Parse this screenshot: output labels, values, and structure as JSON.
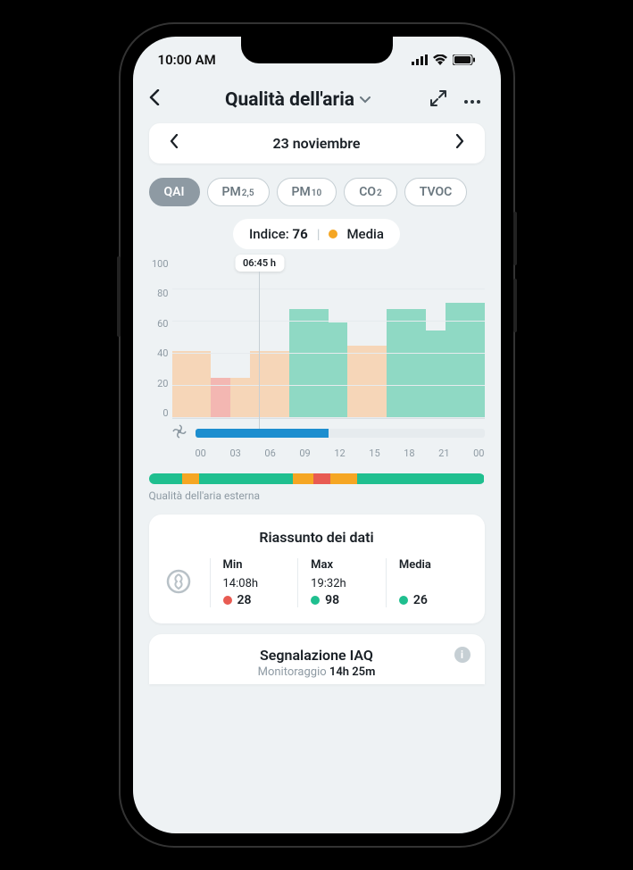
{
  "status_bar": {
    "time": "10:00 AM"
  },
  "header": {
    "title": "Qualità dell'aria"
  },
  "date_selector": {
    "date": "23 noviembre"
  },
  "chips": [
    {
      "label": "QAI",
      "sub": "",
      "active": true
    },
    {
      "label": "PM",
      "sub": "2,5",
      "active": false
    },
    {
      "label": "PM",
      "sub": "10",
      "active": false
    },
    {
      "label": "CO",
      "sub": "2",
      "active": false
    },
    {
      "label": "TVOC",
      "sub": "",
      "active": false
    }
  ],
  "index_badge": {
    "prefix": "Indice:",
    "value": "76",
    "status_label": "Media",
    "status_color": "orange"
  },
  "chart_data": {
    "type": "bar",
    "ylim": [
      0,
      100
    ],
    "y_ticks": [
      100,
      80,
      60,
      40,
      20,
      0
    ],
    "x_ticks": [
      "00",
      "03",
      "06",
      "09",
      "12",
      "15",
      "18",
      "21",
      "00"
    ],
    "tooltip": {
      "label": "06:45 h",
      "x_fraction": 0.28
    },
    "series": [
      {
        "h": 42,
        "color": "peach"
      },
      {
        "h": 42,
        "color": "peach"
      },
      {
        "h": 25,
        "color": "pink"
      },
      {
        "h": 25,
        "color": "peach"
      },
      {
        "h": 42,
        "color": "peach"
      },
      {
        "h": 42,
        "color": "peach"
      },
      {
        "h": 68,
        "color": "teal"
      },
      {
        "h": 68,
        "color": "teal"
      },
      {
        "h": 60,
        "color": "teal"
      },
      {
        "h": 45,
        "color": "peach"
      },
      {
        "h": 45,
        "color": "peach"
      },
      {
        "h": 68,
        "color": "teal"
      },
      {
        "h": 68,
        "color": "teal"
      },
      {
        "h": 55,
        "color": "teal"
      },
      {
        "h": 72,
        "color": "teal"
      },
      {
        "h": 72,
        "color": "teal"
      }
    ],
    "fan_fill_fraction": 0.46
  },
  "outdoor_bar": {
    "segments": [
      {
        "color": "#1fbf8f",
        "w": 10
      },
      {
        "color": "#f5a623",
        "w": 5
      },
      {
        "color": "#1fbf8f",
        "w": 28
      },
      {
        "color": "#f5a623",
        "w": 6
      },
      {
        "color": "#e85b52",
        "w": 5
      },
      {
        "color": "#f5a623",
        "w": 8
      },
      {
        "color": "#1fbf8f",
        "w": 38
      }
    ],
    "label": "Qualità dell'aria esterna"
  },
  "summary": {
    "title": "Riassunto dei dati",
    "cols": {
      "min": {
        "label": "Min",
        "time": "14:08h",
        "value": "28",
        "dot": "red"
      },
      "max": {
        "label": "Max",
        "time": "19:32h",
        "value": "98",
        "dot": "green"
      },
      "avg": {
        "label": "Media",
        "time": "",
        "value": "26",
        "dot": "green"
      }
    }
  },
  "iaq": {
    "title": "Segnalazione IAQ",
    "sub_prefix": "Monitoraggio",
    "sub_value": "14h 25m"
  }
}
